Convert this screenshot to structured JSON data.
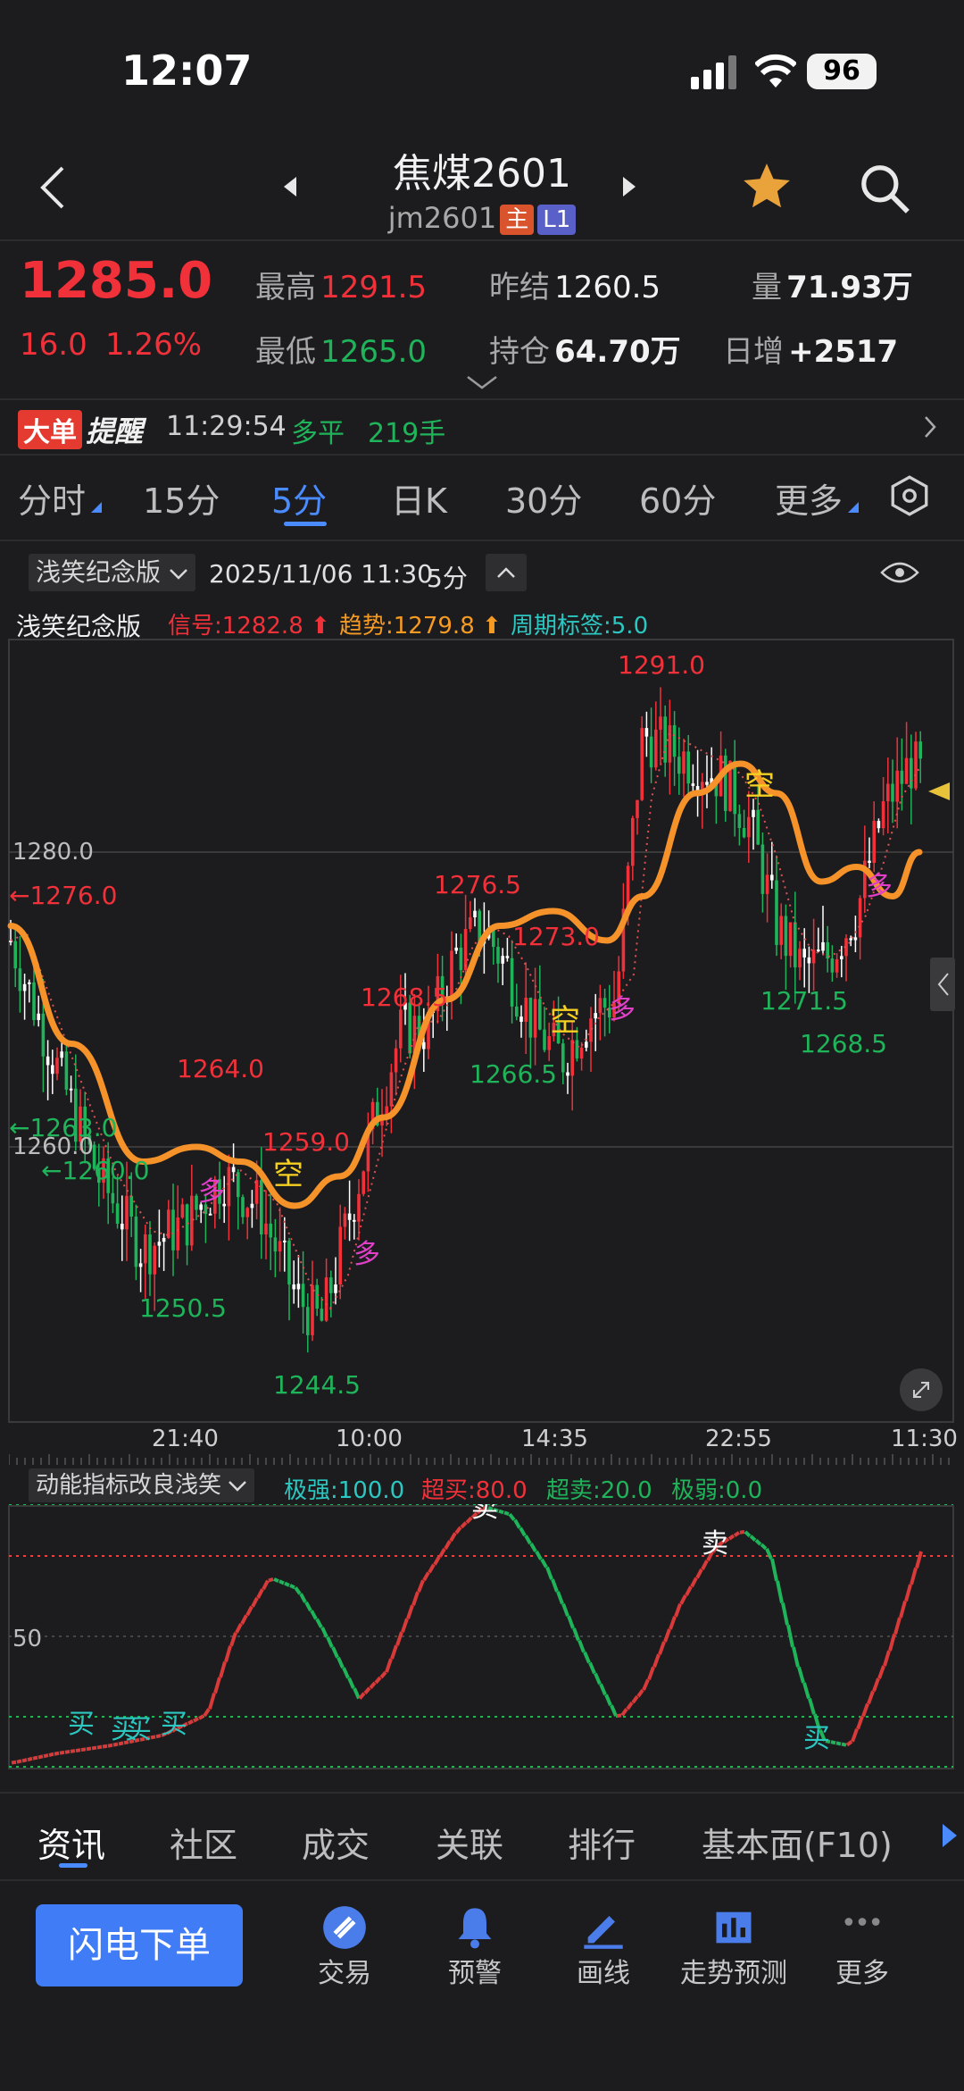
{
  "status": {
    "time": "12:07",
    "battery": "96"
  },
  "header": {
    "title": "焦煤2601",
    "code": "jm2601",
    "tag_main": "主",
    "tag_level": "L1"
  },
  "quote": {
    "price": "1285.0",
    "change": "16.0",
    "change_pct": "1.26%",
    "high_label": "最高",
    "high": "1291.5",
    "low_label": "最低",
    "low": "1265.0",
    "prev_settle_label": "昨结",
    "prev_settle": "1260.5",
    "open_interest_label": "持仓",
    "open_interest": "64.70万",
    "volume_label": "量",
    "volume": "71.93万",
    "daily_add_label": "日增",
    "daily_add": "+2517"
  },
  "alert": {
    "label_big": "大单",
    "label_tip": "提醒",
    "time": "11:29:54",
    "type": "多平",
    "qty": "219手"
  },
  "tabs": [
    {
      "label": "分时"
    },
    {
      "label": "15分"
    },
    {
      "label": "5分"
    },
    {
      "label": "日K"
    },
    {
      "label": "30分"
    },
    {
      "label": "60分"
    },
    {
      "label": "更多"
    }
  ],
  "chart_header": {
    "indicator": "浅笑纪念版",
    "datetime": "2025/11/06 11:30",
    "period": "5分",
    "legend_name": "浅笑纪念版",
    "signal": "信号:1282.8",
    "trend": "趋势:1279.8",
    "cycle": "周期标签:5.0"
  },
  "chart_labels": {
    "price_axis": [
      "1280.0",
      "1260.0"
    ],
    "left_marks": [
      "←1276.0",
      "←1263.0",
      "←1260.0"
    ],
    "highs": [
      "1291.0",
      "1276.5",
      "1273.0",
      "1268.5",
      "1264.0",
      "1259.0"
    ],
    "lows": [
      "1250.5",
      "1244.5",
      "1266.5",
      "1271.5",
      "1268.5"
    ],
    "signals_duo": "多",
    "signals_kong": "空",
    "time_axis": [
      "21:40",
      "10:00",
      "14:35",
      "22:55",
      "11:30"
    ]
  },
  "sub_chart": {
    "indicator": "动能指标改良浅笑",
    "strong": "极强:100.0",
    "overbought": "超买:80.0",
    "oversold": "超卖:20.0",
    "weak": "极弱:0.0",
    "axis_mid": "50",
    "buy": "买",
    "sell": "卖"
  },
  "bottom_tabs": [
    {
      "label": "资讯"
    },
    {
      "label": "社区"
    },
    {
      "label": "成交"
    },
    {
      "label": "关联"
    },
    {
      "label": "排行"
    },
    {
      "label": "基本面(F10)"
    }
  ],
  "bottom_nav": {
    "order_button": "闪电下单",
    "items": [
      {
        "label": "交易"
      },
      {
        "label": "预警"
      },
      {
        "label": "画线"
      },
      {
        "label": "走势预测"
      },
      {
        "label": "更多"
      }
    ]
  },
  "colors": {
    "up": "#f0313a",
    "down": "#1fb35a",
    "accent": "#4a8cff",
    "trend": "#f59a23"
  }
}
